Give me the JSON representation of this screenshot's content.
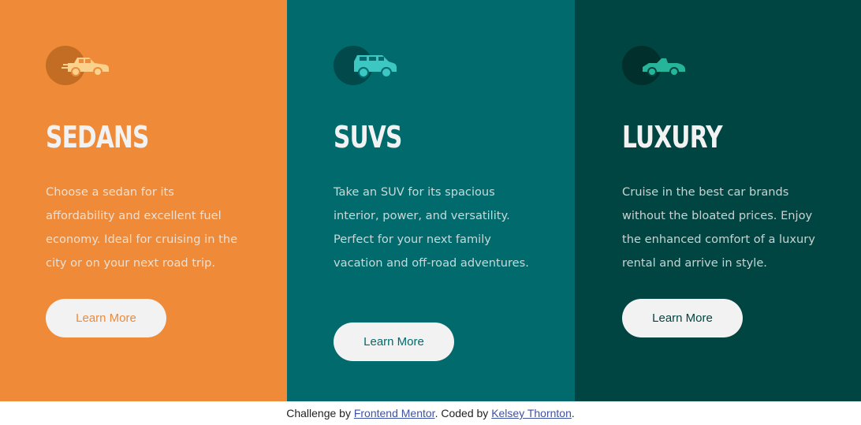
{
  "colors": {
    "sedans": "#ee8a38",
    "suvs": "#016a6c",
    "luxury": "#014542",
    "button_bg": "#f2f2f2",
    "link": "#3e52a3"
  },
  "cards": [
    {
      "icon": "sedan-car-icon",
      "title": "SEDANS",
      "text": "Choose a sedan for its affordability and excellent fuel economy. Ideal for cruising in the city or on your next road trip.",
      "button_label": "Learn More"
    },
    {
      "icon": "suv-car-icon",
      "title": "SUVS",
      "text": "Take an SUV for its spacious interior, power, and versatility. Perfect for your next family vacation and off-road adventures.",
      "button_label": "Learn More"
    },
    {
      "icon": "luxury-car-icon",
      "title": "LUXURY",
      "text": "Cruise in the best car brands without the bloated prices. Enjoy the enhanced comfort of a luxury rental and arrive in style.",
      "button_label": "Learn More"
    }
  ],
  "attribution": {
    "prefix": "Challenge by ",
    "challenge_link": "Frontend Mentor",
    "middle": ". Coded by ",
    "author_link": "Kelsey Thornton",
    "suffix": "."
  }
}
